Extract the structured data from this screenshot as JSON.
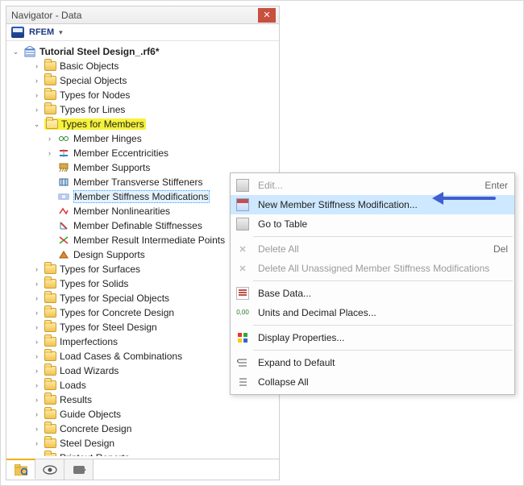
{
  "panel": {
    "title": "Navigator - Data",
    "app_label": "RFEM"
  },
  "tree": {
    "root_label": "Tutorial Steel Design_.rf6*",
    "nodes": [
      {
        "ind": 2,
        "toggle": ">",
        "icon": "folder",
        "label": "Basic Objects"
      },
      {
        "ind": 2,
        "toggle": ">",
        "icon": "folder",
        "label": "Special Objects"
      },
      {
        "ind": 2,
        "toggle": ">",
        "icon": "folder",
        "label": "Types for Nodes"
      },
      {
        "ind": 2,
        "toggle": ">",
        "icon": "folder",
        "label": "Types for Lines"
      },
      {
        "ind": 2,
        "toggle": "v",
        "icon": "folder-open",
        "label": "Types for Members",
        "hl": true
      },
      {
        "ind": 3,
        "toggle": ">",
        "icon": "hinge",
        "label": "Member Hinges"
      },
      {
        "ind": 3,
        "toggle": ">",
        "icon": "ecc",
        "label": "Member Eccentricities"
      },
      {
        "ind": 3,
        "toggle": "",
        "icon": "support",
        "label": "Member Supports"
      },
      {
        "ind": 3,
        "toggle": "",
        "icon": "stiff",
        "label": "Member Transverse Stiffeners"
      },
      {
        "ind": 3,
        "toggle": "",
        "icon": "mod",
        "label": "Member Stiffness Modifications",
        "sel": true
      },
      {
        "ind": 3,
        "toggle": "",
        "icon": "nonlin",
        "label": "Member Nonlinearities"
      },
      {
        "ind": 3,
        "toggle": "",
        "icon": "defstiff",
        "label": "Member Definable Stiffnesses"
      },
      {
        "ind": 3,
        "toggle": "",
        "icon": "result",
        "label": "Member Result Intermediate Points"
      },
      {
        "ind": 3,
        "toggle": "",
        "icon": "design",
        "label": "Design Supports"
      },
      {
        "ind": 2,
        "toggle": ">",
        "icon": "folder",
        "label": "Types for Surfaces"
      },
      {
        "ind": 2,
        "toggle": ">",
        "icon": "folder",
        "label": "Types for Solids"
      },
      {
        "ind": 2,
        "toggle": ">",
        "icon": "folder",
        "label": "Types for Special Objects"
      },
      {
        "ind": 2,
        "toggle": ">",
        "icon": "folder",
        "label": "Types for Concrete Design"
      },
      {
        "ind": 2,
        "toggle": ">",
        "icon": "folder",
        "label": "Types for Steel Design"
      },
      {
        "ind": 2,
        "toggle": ">",
        "icon": "folder",
        "label": "Imperfections"
      },
      {
        "ind": 2,
        "toggle": ">",
        "icon": "folder",
        "label": "Load Cases & Combinations"
      },
      {
        "ind": 2,
        "toggle": ">",
        "icon": "folder",
        "label": "Load Wizards"
      },
      {
        "ind": 2,
        "toggle": ">",
        "icon": "folder",
        "label": "Loads"
      },
      {
        "ind": 2,
        "toggle": ">",
        "icon": "folder",
        "label": "Results"
      },
      {
        "ind": 2,
        "toggle": ">",
        "icon": "folder",
        "label": "Guide Objects"
      },
      {
        "ind": 2,
        "toggle": ">",
        "icon": "folder",
        "label": "Concrete Design"
      },
      {
        "ind": 2,
        "toggle": ">",
        "icon": "folder",
        "label": "Steel Design"
      },
      {
        "ind": 2,
        "toggle": ">",
        "icon": "folder",
        "label": "Printout Reports"
      }
    ]
  },
  "menu": {
    "items": [
      {
        "icon": "grid",
        "label": "Edit...",
        "shortcut": "Enter",
        "disabled": true
      },
      {
        "icon": "grid-cal",
        "label": "New Member Stiffness Modification...",
        "hl": true
      },
      {
        "icon": "grid",
        "label": "Go to Table"
      },
      {
        "sep": true
      },
      {
        "icon": "x",
        "label": "Delete All",
        "shortcut": "Del",
        "disabled": true
      },
      {
        "icon": "x",
        "label": "Delete All Unassigned Member Stiffness Modifications",
        "disabled": true
      },
      {
        "sep": true
      },
      {
        "icon": "doc",
        "label": "Base Data..."
      },
      {
        "icon": "num",
        "label": "Units and Decimal Places..."
      },
      {
        "sep": true
      },
      {
        "icon": "color",
        "label": "Display Properties..."
      },
      {
        "sep": true
      },
      {
        "icon": "expand",
        "label": "Expand to Default"
      },
      {
        "icon": "collapse",
        "label": "Collapse All"
      }
    ]
  }
}
